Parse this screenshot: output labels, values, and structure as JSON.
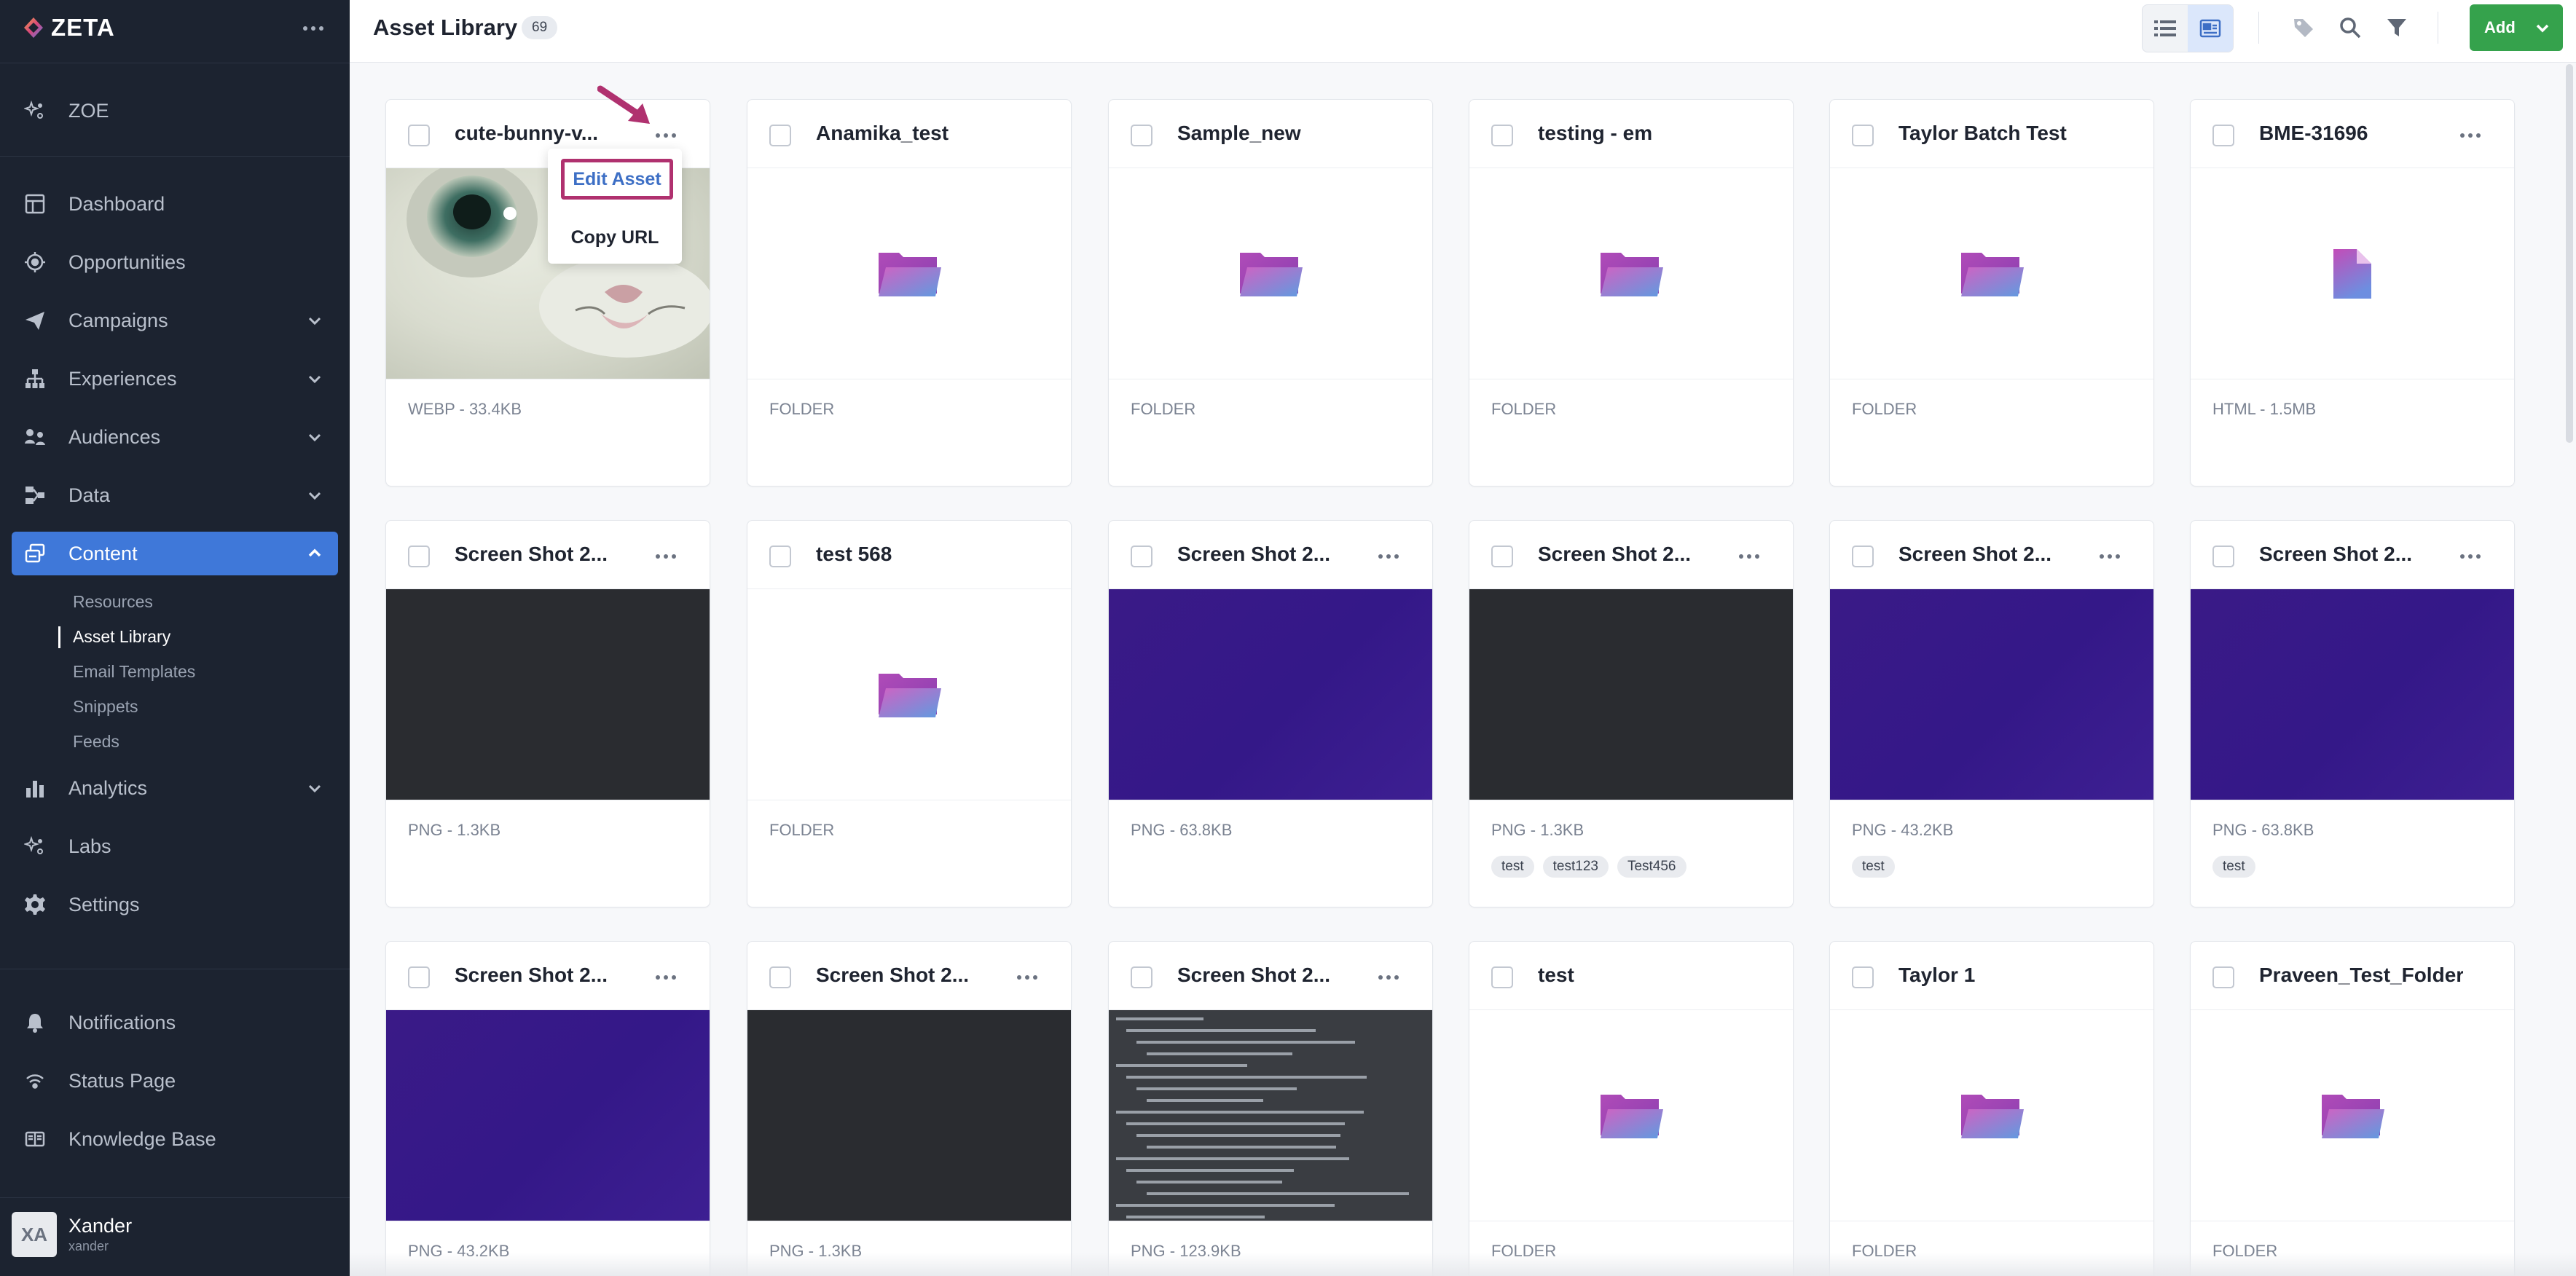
{
  "brand": {
    "name": "ZETA"
  },
  "sidebar": {
    "top_item": {
      "label": "ZOE",
      "icon": "sparkle-icon"
    },
    "items": [
      {
        "label": "Dashboard",
        "icon": "dashboard-icon",
        "expandable": false,
        "active": false
      },
      {
        "label": "Opportunities",
        "icon": "target-icon",
        "expandable": false,
        "active": false
      },
      {
        "label": "Campaigns",
        "icon": "paper-plane-icon",
        "expandable": true,
        "active": false
      },
      {
        "label": "Experiences",
        "icon": "hierarchy-icon",
        "expandable": true,
        "active": false
      },
      {
        "label": "Audiences",
        "icon": "audience-icon",
        "expandable": true,
        "active": false
      },
      {
        "label": "Data",
        "icon": "data-flow-icon",
        "expandable": true,
        "active": false
      },
      {
        "label": "Content",
        "icon": "content-icon",
        "expandable": true,
        "active": true
      },
      {
        "label": "Analytics",
        "icon": "bar-chart-icon",
        "expandable": true,
        "active": false
      },
      {
        "label": "Labs",
        "icon": "labs-sparkle-icon",
        "expandable": false,
        "active": false
      },
      {
        "label": "Settings",
        "icon": "gear-icon",
        "expandable": false,
        "active": false
      }
    ],
    "content_subitems": [
      "Resources",
      "Asset Library",
      "Email Templates",
      "Snippets",
      "Feeds"
    ],
    "current_subitem": "Asset Library",
    "footer_items": [
      {
        "label": "Notifications",
        "icon": "bell-icon"
      },
      {
        "label": "Status Page",
        "icon": "signal-icon"
      },
      {
        "label": "Knowledge Base",
        "icon": "book-icon"
      }
    ],
    "user": {
      "initials": "XA",
      "name": "Xander",
      "handle": "xander"
    }
  },
  "header": {
    "title": "Asset Library",
    "count": "69",
    "add_label": "Add",
    "view_modes": [
      "list-view-icon",
      "card-view-icon"
    ],
    "selected_view": "card-view-icon"
  },
  "menu": {
    "edit": "Edit Asset",
    "copy": "Copy URL"
  },
  "assets": [
    {
      "title": "cute-bunny-v...",
      "meta": "WEBP - 33.4KB",
      "preview": "bunny",
      "more": true,
      "tags": []
    },
    {
      "title": "Anamika_test",
      "meta": "FOLDER",
      "preview": "folder",
      "more": false,
      "tags": []
    },
    {
      "title": "Sample_new",
      "meta": "FOLDER",
      "preview": "folder",
      "more": false,
      "tags": []
    },
    {
      "title": "testing - em",
      "meta": "FOLDER",
      "preview": "folder",
      "more": false,
      "tags": []
    },
    {
      "title": "Taylor Batch Test",
      "meta": "FOLDER",
      "preview": "folder",
      "more": false,
      "tags": []
    },
    {
      "title": "BME-31696",
      "meta": "HTML - 1.5MB",
      "preview": "file",
      "more": true,
      "tags": []
    },
    {
      "title": "Screen Shot 2...",
      "meta": "PNG - 1.3KB",
      "preview": "dark",
      "more": true,
      "tags": []
    },
    {
      "title": "test 568",
      "meta": "FOLDER",
      "preview": "folder",
      "more": false,
      "tags": []
    },
    {
      "title": "Screen Shot 2...",
      "meta": "PNG - 63.8KB",
      "preview": "purple",
      "more": true,
      "tags": []
    },
    {
      "title": "Screen Shot 2...",
      "meta": "PNG - 1.3KB",
      "preview": "dark",
      "more": true,
      "tags": [
        "test",
        "test123",
        "Test456"
      ]
    },
    {
      "title": "Screen Shot 2...",
      "meta": "PNG - 43.2KB",
      "preview": "purple",
      "more": true,
      "tags": [
        "test"
      ]
    },
    {
      "title": "Screen Shot 2...",
      "meta": "PNG - 63.8KB",
      "preview": "purple",
      "more": true,
      "tags": [
        "test"
      ]
    },
    {
      "title": "Screen Shot 2...",
      "meta": "PNG - 43.2KB",
      "preview": "purple",
      "more": true,
      "tags": []
    },
    {
      "title": "Screen Shot 2...",
      "meta": "PNG - 1.3KB",
      "preview": "dark",
      "more": true,
      "tags": []
    },
    {
      "title": "Screen Shot 2...",
      "meta": "PNG - 123.9KB",
      "preview": "doc",
      "more": true,
      "tags": []
    },
    {
      "title": "test",
      "meta": "FOLDER",
      "preview": "folder",
      "more": false,
      "tags": []
    },
    {
      "title": "Taylor 1",
      "meta": "FOLDER",
      "preview": "folder",
      "more": false,
      "tags": []
    },
    {
      "title": "Praveen_Test_Folder",
      "meta": "FOLDER",
      "preview": "folder",
      "more": false,
      "tags": []
    }
  ]
}
